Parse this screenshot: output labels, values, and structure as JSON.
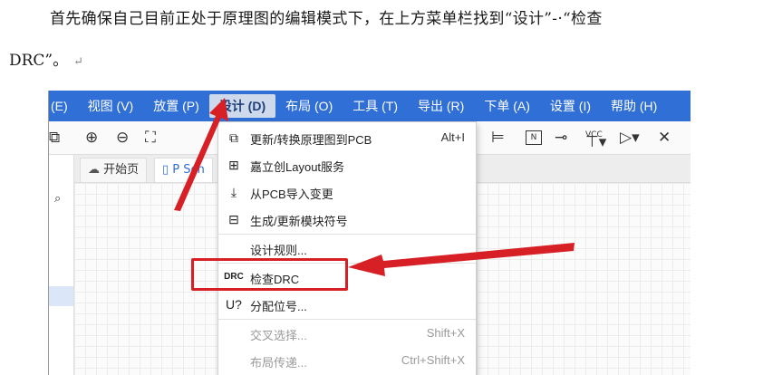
{
  "doc": {
    "line1": "首先确保自己目前正处于原理图的编辑模式下，在上方菜单栏找到“设计”-·“检查",
    "line2": "DRC”。",
    "para_mark": "↵"
  },
  "menubar": {
    "items": [
      "(E)",
      "视图 (V)",
      "放置 (P)",
      "设计 (D)",
      "布局 (O)",
      "工具 (T)",
      "导出 (R)",
      "下单 (A)",
      "设置 (I)",
      "帮助 (H)"
    ],
    "active_index": 3
  },
  "tabs": {
    "home": "开始页",
    "schematic": "P Sch"
  },
  "toolbar": {
    "n_label": "N",
    "vcc_label": "VCC"
  },
  "dropdown": {
    "items": [
      {
        "icon": "update-pcb-icon",
        "label": "更新/转换原理图到PCB",
        "shortcut": "Alt+I",
        "disabled": false
      },
      {
        "icon": "layout-service-icon",
        "label": "嘉立创Layout服务",
        "shortcut": "",
        "disabled": false
      },
      {
        "icon": "import-changes-icon",
        "label": "从PCB导入变更",
        "shortcut": "",
        "disabled": false
      },
      {
        "icon": "module-symbol-icon",
        "label": "生成/更新模块符号",
        "shortcut": "",
        "disabled": false
      },
      {
        "icon": "",
        "label": "设计规则...",
        "shortcut": "",
        "disabled": false
      },
      {
        "icon": "drc-icon",
        "label": "检查DRC",
        "shortcut": "",
        "disabled": false
      },
      {
        "icon": "assign-designator-icon",
        "label": "分配位号...",
        "shortcut": "",
        "disabled": false
      },
      {
        "icon": "",
        "label": "交叉选择...",
        "shortcut": "Shift+X",
        "disabled": true
      },
      {
        "icon": "",
        "label": "布局传递...",
        "shortcut": "Ctrl+Shift+X",
        "disabled": true
      }
    ],
    "drc_icon_text": "DRC",
    "assign_icon_text": "U?"
  },
  "colors": {
    "menubar": "#2f6fd6",
    "highlight": "#d71f26"
  }
}
